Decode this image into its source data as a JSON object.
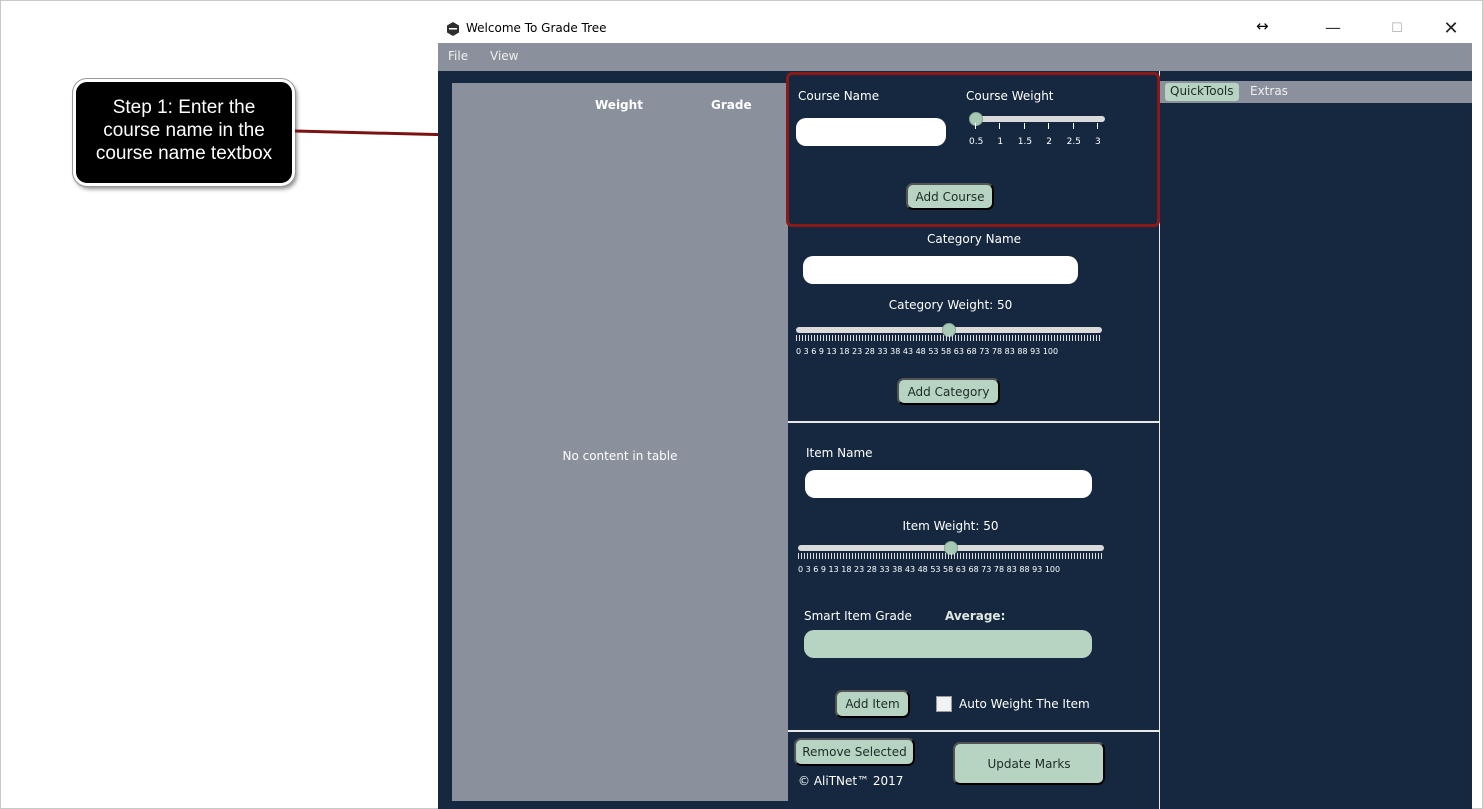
{
  "window": {
    "title": "Welcome To Grade Tree",
    "resize_glyph": "↔",
    "minimize_glyph": "—",
    "maximize_glyph": "☐",
    "close_glyph": "✕"
  },
  "menu": {
    "items": [
      "File",
      "View"
    ]
  },
  "table": {
    "columns": [
      "Weight",
      "Grade"
    ],
    "empty_message": "No content in table"
  },
  "course": {
    "name_label": "Course Name",
    "name_value": "",
    "weight_label": "Course Weight",
    "weight_ticks": [
      "0.5",
      "1",
      "1.5",
      "2",
      "2.5",
      "3"
    ],
    "weight_value": 0.5,
    "add_button": "Add Course"
  },
  "category": {
    "name_label": "Category Name",
    "name_value": "",
    "weight_label": "Category Weight: 50",
    "weight_value": 50,
    "tick_labels": "0 3 6 9 13 18 23 28 33 38 43 48 53 58 63 68 73 78 83 88 93 100",
    "add_button": "Add Category"
  },
  "item": {
    "name_label": "Item Name",
    "name_value": "",
    "weight_label": "Item Weight: 50",
    "weight_value": 50,
    "tick_labels": "0 3 6 9 13 18 23 28 33 38 43 48 53 58 63 68 73 78 83 88 93 100",
    "smart_grade_label": "Smart Item Grade",
    "average_label": "Average:",
    "smart_grade_value": "",
    "add_button": "Add Item",
    "auto_weight_label": "Auto Weight The Item"
  },
  "footer": {
    "remove_button": "Remove Selected",
    "update_button": "Update Marks",
    "copyright": "© AliTNet™ 2017"
  },
  "tabs": [
    {
      "label": "QuickTools",
      "active": true
    },
    {
      "label": "Extras",
      "active": false
    }
  ],
  "callout": {
    "lines": [
      "Step 1: Enter the",
      "course name in the",
      "course name textbox"
    ]
  },
  "colors": {
    "app_bg": "#16283f",
    "panel_gray": "#8a919c",
    "accent_green": "#b7d4c2",
    "highlight_red": "#8a1a1a"
  }
}
